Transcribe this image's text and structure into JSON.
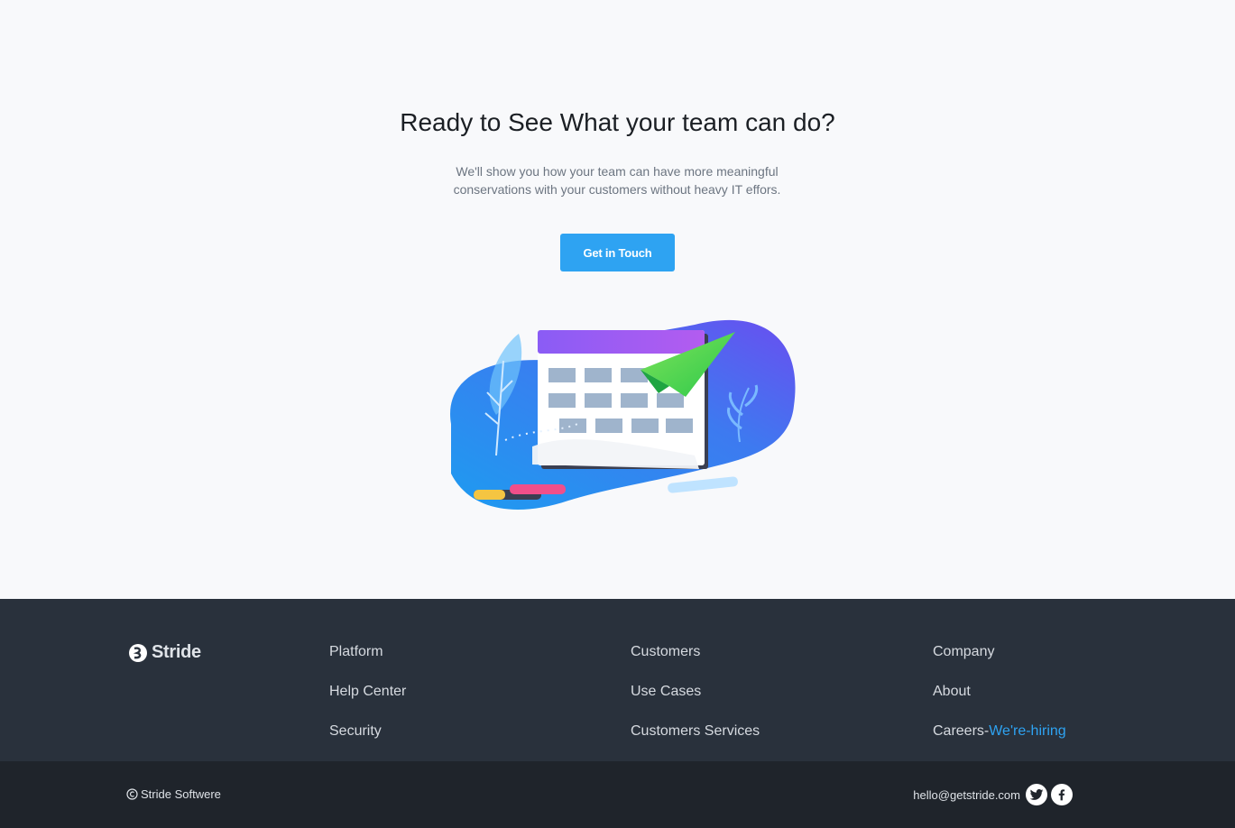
{
  "hero": {
    "title": "Ready to See What your team can do?",
    "subtitle_line1": "We'll show you how your team can have more meaningful",
    "subtitle_line2": "conservations with your customers without heavy IT effors.",
    "cta_label": "Get in Touch"
  },
  "footer": {
    "brand_name": "Stride",
    "brand_icon": "stride-logo-icon",
    "columns": [
      {
        "links": [
          "Platform",
          "Help Center",
          "Security"
        ]
      },
      {
        "links": [
          "Customers",
          "Use Cases",
          "Customers Services"
        ]
      },
      {
        "links": [
          "Company",
          "About",
          "Careers-"
        ]
      }
    ],
    "hiring_label": "We're-hiring",
    "copyright_text": "Stride Softwere",
    "email": "hello@getstride.com",
    "social_icons": [
      "twitter-icon",
      "facebook-icon"
    ]
  },
  "colors": {
    "accent": "#2ea3f2",
    "hero_bg": "#f8f9fb",
    "footer_top_bg": "#29313c",
    "footer_bottom_bg": "#1f242b"
  }
}
